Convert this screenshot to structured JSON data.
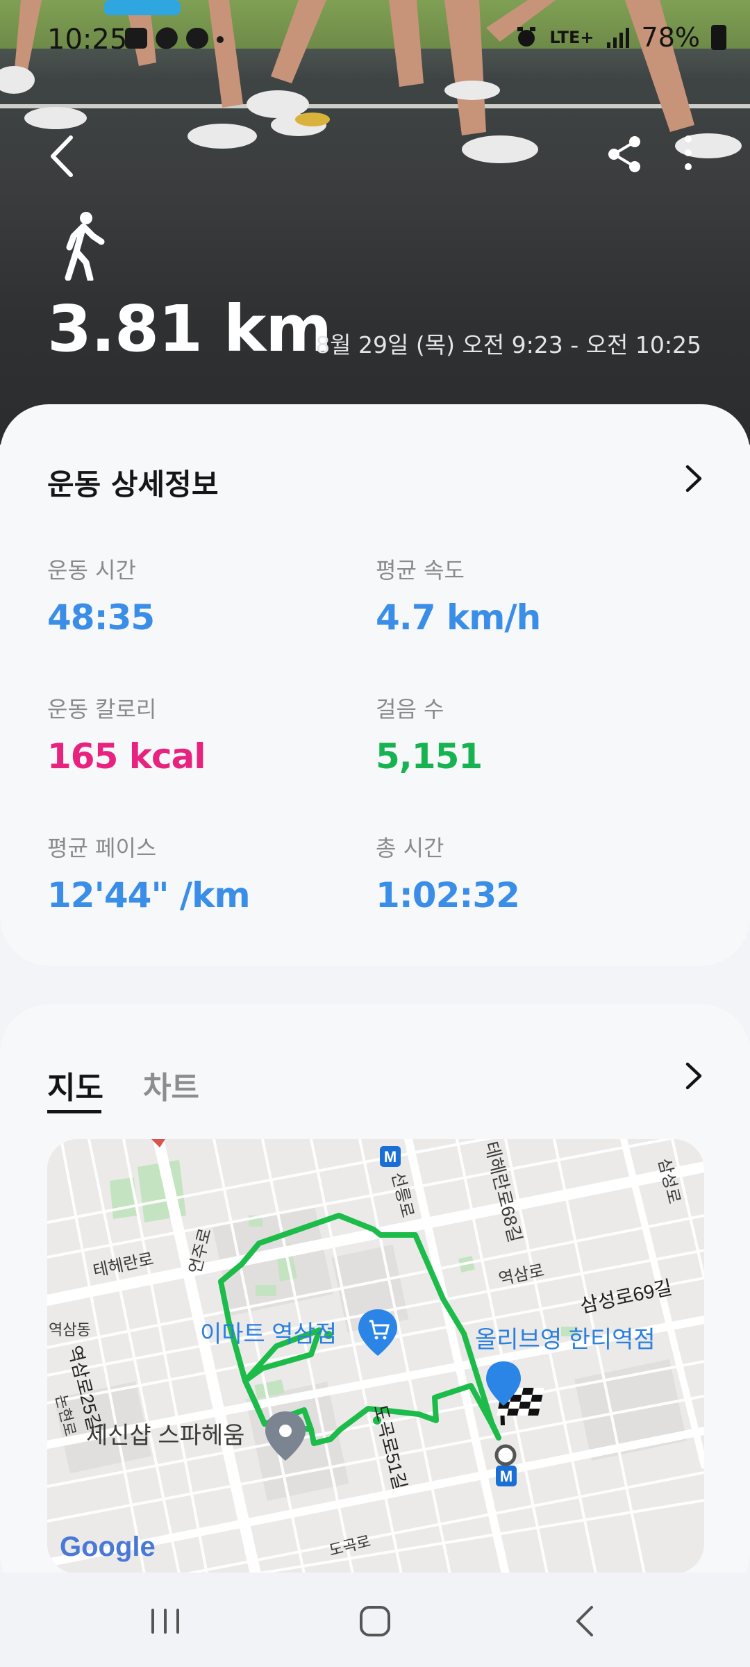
{
  "status_bar": {
    "time": "10:25",
    "network": "LTE+",
    "battery": "78%"
  },
  "header": {
    "distance": "3.81 km",
    "date_range": "8월 29일 (목) 오전 9:23 - 오전 10:25"
  },
  "details": {
    "title": "운동 상세정보",
    "stats": [
      {
        "label": "운동 시간",
        "value": "48:35",
        "color": "#3b8ee8"
      },
      {
        "label": "평균 속도",
        "value": "4.7 km/h",
        "color": "#3b8ee8"
      },
      {
        "label": "운동 칼로리",
        "value": "165 kcal",
        "color": "#e8237f"
      },
      {
        "label": "걸음 수",
        "value": "5,151",
        "color": "#17b351"
      },
      {
        "label": "평균 페이스",
        "value": "12'44\" /km",
        "color": "#3b8ee8"
      },
      {
        "label": "총 시간",
        "value": "1:02:32",
        "color": "#3b8ee8"
      }
    ]
  },
  "tabs": {
    "map": "지도",
    "chart": "차트"
  },
  "map": {
    "labels": {
      "emart": "이마트 역삼점",
      "oliveyoung": "올리브영 한티역점",
      "sesinsap": "세신샵 스파헤움",
      "teheran": "테헤란로",
      "teheran68": "테헤란로68길",
      "samseong69": "삼성로69길",
      "samseongro": "삼성로",
      "yeoksamdong": "역삼동",
      "yeoksamro": "역삼로",
      "yeoksamro25": "역삼로25길",
      "eonjuro": "언주로",
      "seolleungro": "선릉로",
      "dogokro51": "도곡로51길",
      "dogokro": "도곡로",
      "nonhyeon": "논현로",
      "google": "Google"
    },
    "route_color": "#1dbb4a"
  }
}
